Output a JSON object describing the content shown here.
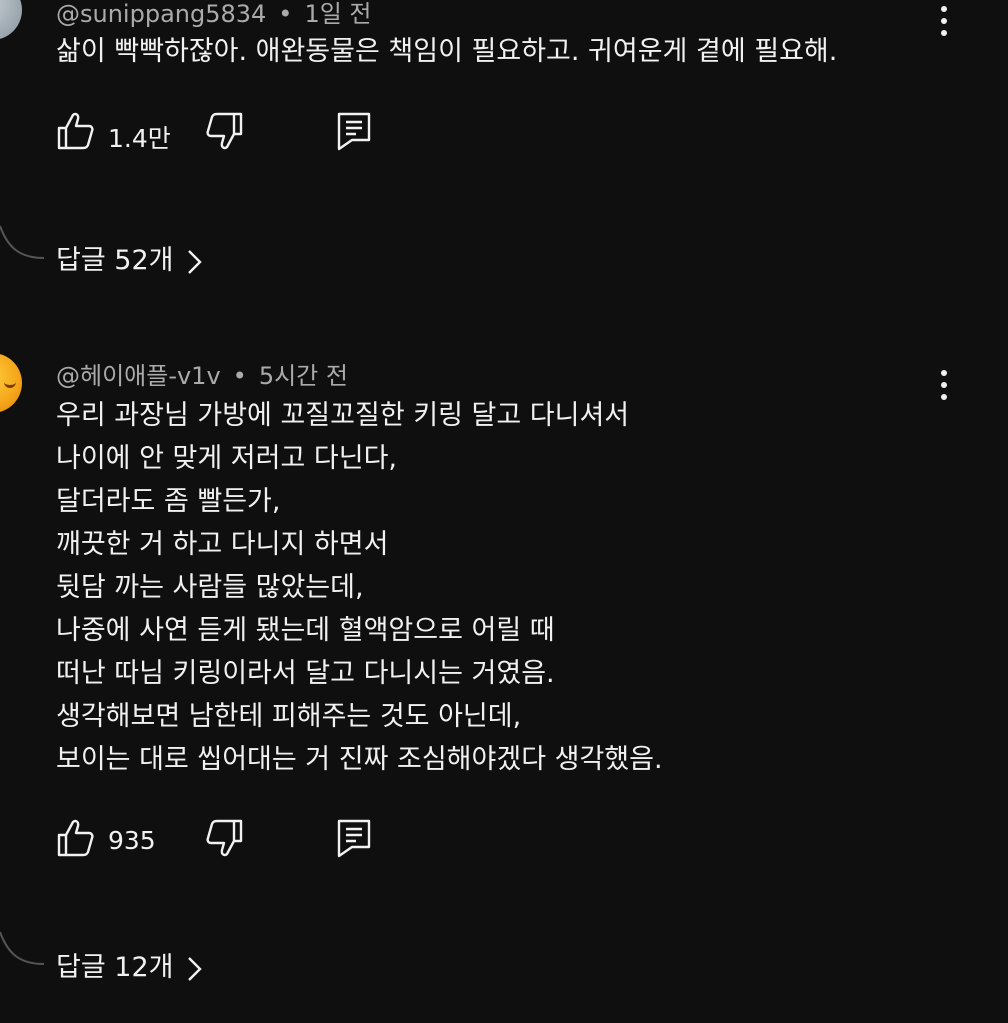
{
  "comments": [
    {
      "author": "@sunippang5834",
      "time": "1일 전",
      "lines": [
        "삶이 빡빡하잖아. 애완동물은 책임이 필요하고. 귀여운게 곁에 필요해."
      ],
      "likes": "1.4만",
      "replies_label": "답글 52개"
    },
    {
      "author": "@헤이애플-v1v",
      "time": "5시간 전",
      "lines": [
        "우리 과장님 가방에 꼬질꼬질한 키링 달고 다니셔서",
        "나이에 안 맞게 저러고 다닌다,",
        "달더라도 좀 빨든가,",
        "깨끗한 거 하고 다니지 하면서",
        "뒷담 까는 사람들 많았는데,",
        "나중에 사연 듣게 됐는데 혈액암으로 어릴 때",
        "떠난 따님 키링이라서 달고 다니시는 거였음.",
        "생각해보면 남한테 피해주는 것도 아닌데,",
        "보이는 대로 씹어대는 거 진짜 조심해야겠다 생각했음."
      ],
      "likes": "935",
      "replies_label": "답글 12개"
    }
  ],
  "separator": "•",
  "icons": {
    "like": "thumbs-up-icon",
    "dislike": "thumbs-down-icon",
    "reply": "reply-icon",
    "more": "more-vert-icon",
    "chevron": "chevron-right-icon"
  }
}
